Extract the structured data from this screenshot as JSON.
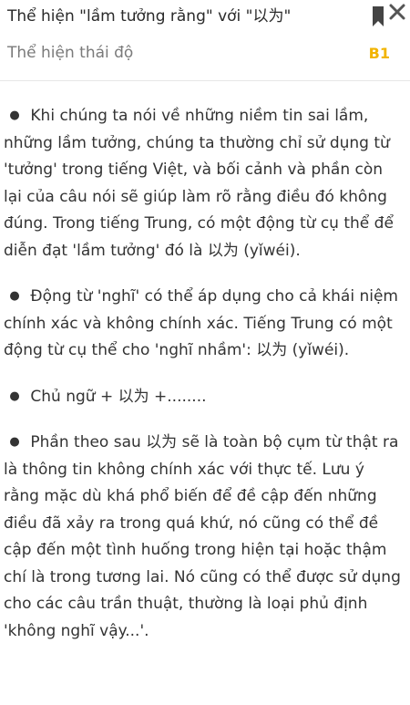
{
  "header": {
    "title": "Thể hiện \"lầm tưởng rằng\" với \"以为\"",
    "subtitle": "Thể hiện thái độ",
    "level": "B1",
    "bookmark_icon": "bookmark-icon",
    "close_icon": "close-icon",
    "accent_color": "#f2b400"
  },
  "content": {
    "bullet": "●",
    "paragraphs": [
      "Khi chúng ta nói về những niềm tin sai lầm, những lầm tưởng, chúng ta thường chỉ sử dụng từ 'tưởng' trong tiếng Việt, và bối cảnh và phần còn lại của câu nói sẽ giúp làm rõ rằng điều đó không đúng. Trong tiếng Trung, có một động từ cụ thể để diễn đạt 'lầm tưởng' đó là 以为 (yǐwéi).",
      "Động từ 'nghĩ' có thể áp dụng cho cả khái niệm chính xác và không chính xác. Tiếng Trung có một động từ cụ thể cho 'nghĩ nhầm': 以为 (yǐwéi).",
      "Chủ ngữ + 以为 +........",
      "Phần theo sau 以为 sẽ là toàn bộ cụm từ thật ra là thông tin không chính xác với thực tế. Lưu ý rằng mặc dù khá phổ biến để đề cập đến những điều đã xảy ra trong quá khứ, nó cũng có thể đề cập đến một tình huống trong hiện tại hoặc thậm chí là trong tương lai. Nó cũng có thể được sử dụng cho các câu trần thuật, thường là loại phủ định 'không nghĩ vậy...'."
    ]
  }
}
